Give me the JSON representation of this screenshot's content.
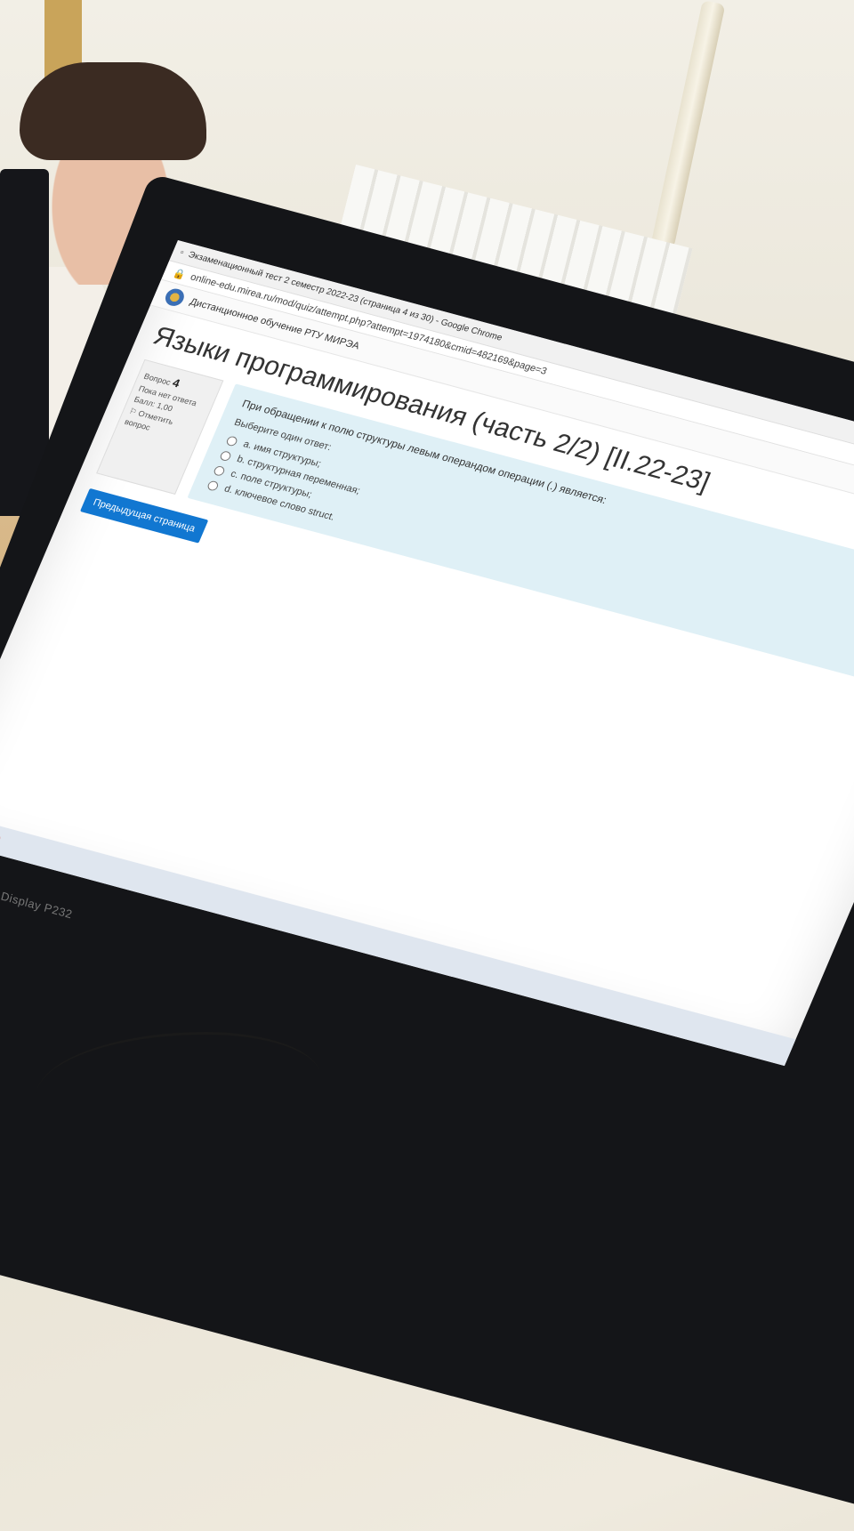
{
  "browser": {
    "window_title": "Экзаменационный тест 2 семестр 2022-23 (страница 4 из 30) - Google Chrome",
    "url": "online-edu.mirea.ru/mod/quiz/attempt.php?attempt=1974180&cmid=482169&page=3"
  },
  "site": {
    "name": "Дистанционное обучение РТУ МИРЭА"
  },
  "course": {
    "title": "Языки программирования (часть 2/2) [II.22-23]"
  },
  "question_info": {
    "label": "Вопрос",
    "number": "4",
    "status": "Пока нет ответа",
    "points": "Балл: 1,00",
    "flag": "Отметить вопрос"
  },
  "question": {
    "text": "При обращении к полю структуры левым операндом операции (.) является:",
    "prompt": "Выберите один ответ:",
    "options": [
      "a. имя структуры;",
      "b. структурная переменная;",
      "c. поле структуры;",
      "d. ключевое слово struct."
    ]
  },
  "navigation": {
    "prev_button": "Предыдущая страница"
  },
  "monitor": {
    "brand": "Display P232"
  },
  "colors": {
    "question_bg": "#dff0f6",
    "button_blue": "#1177d1"
  }
}
